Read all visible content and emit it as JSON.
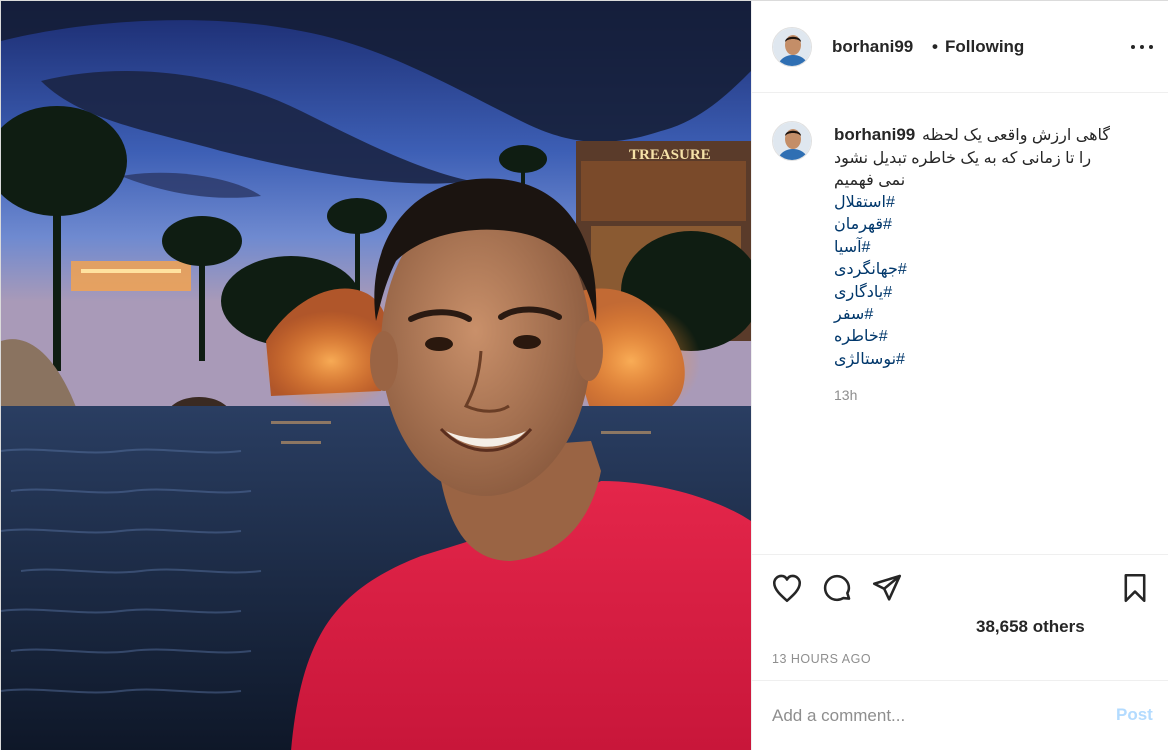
{
  "post": {
    "username": "borhani99",
    "separator": "•",
    "follow_status": "Following",
    "caption": {
      "username": "borhani99",
      "line1": "گاهی ارزش واقعی یک لحظه",
      "line2": "را تا زمانی که به یک خاطره تبدیل نشود",
      "line3": "نمی فهمیم",
      "hashtags": [
        "#استقلال",
        "#قهرمان",
        "#آسیا",
        "#جهانگردی",
        "#یادگاری",
        "#سفر",
        "#خاطره",
        "#نوستالژی"
      ],
      "time": "13h"
    },
    "likes": "38,658 others",
    "posted_ago": "13 HOURS AGO",
    "comment_placeholder": "Add a comment...",
    "post_label": "Post",
    "photo_sign": "TREASURE",
    "icons": {
      "more": "more-options-icon",
      "like": "heart-icon",
      "comment": "comment-icon",
      "share": "share-icon",
      "save": "bookmark-icon"
    },
    "colors": {
      "hashtag": "#00376b",
      "muted": "#8e8e8e",
      "post_button_disabled": "#b3dbff",
      "border": "#efefef"
    }
  }
}
